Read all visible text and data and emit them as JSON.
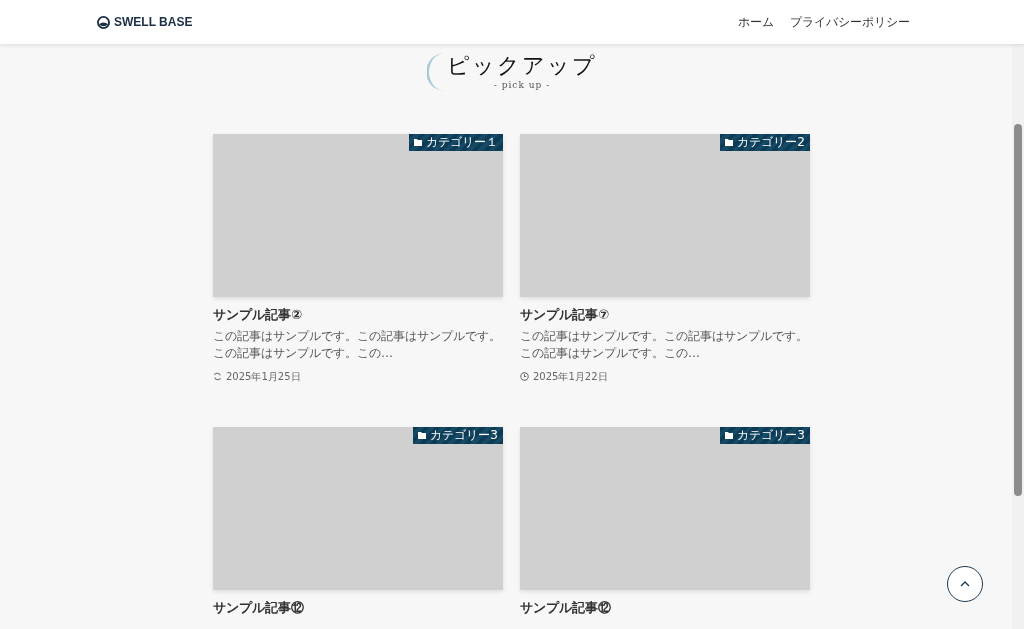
{
  "header": {
    "logo": "SWELL BASE",
    "nav": [
      "ホーム",
      "プライバシーポリシー"
    ]
  },
  "section": {
    "title": "ピックアップ",
    "subtitle": "- pick up -"
  },
  "posts": [
    {
      "category": "カテゴリー１",
      "title": "サンプル記事②",
      "excerpt": "この記事はサンプルです。この記事はサンプルです。この記事はサンプルです。この…",
      "date": "2025年1月25日",
      "updated": true
    },
    {
      "category": "カテゴリー2",
      "title": "サンプル記事⑦",
      "excerpt": "この記事はサンプルです。この記事はサンプルです。この記事はサンプルです。この…",
      "date": "2025年1月22日",
      "updated": false
    },
    {
      "category": "カテゴリー3",
      "title": "サンプル記事⑫"
    },
    {
      "category": "カテゴリー3",
      "title": "サンプル記事⑫"
    }
  ]
}
